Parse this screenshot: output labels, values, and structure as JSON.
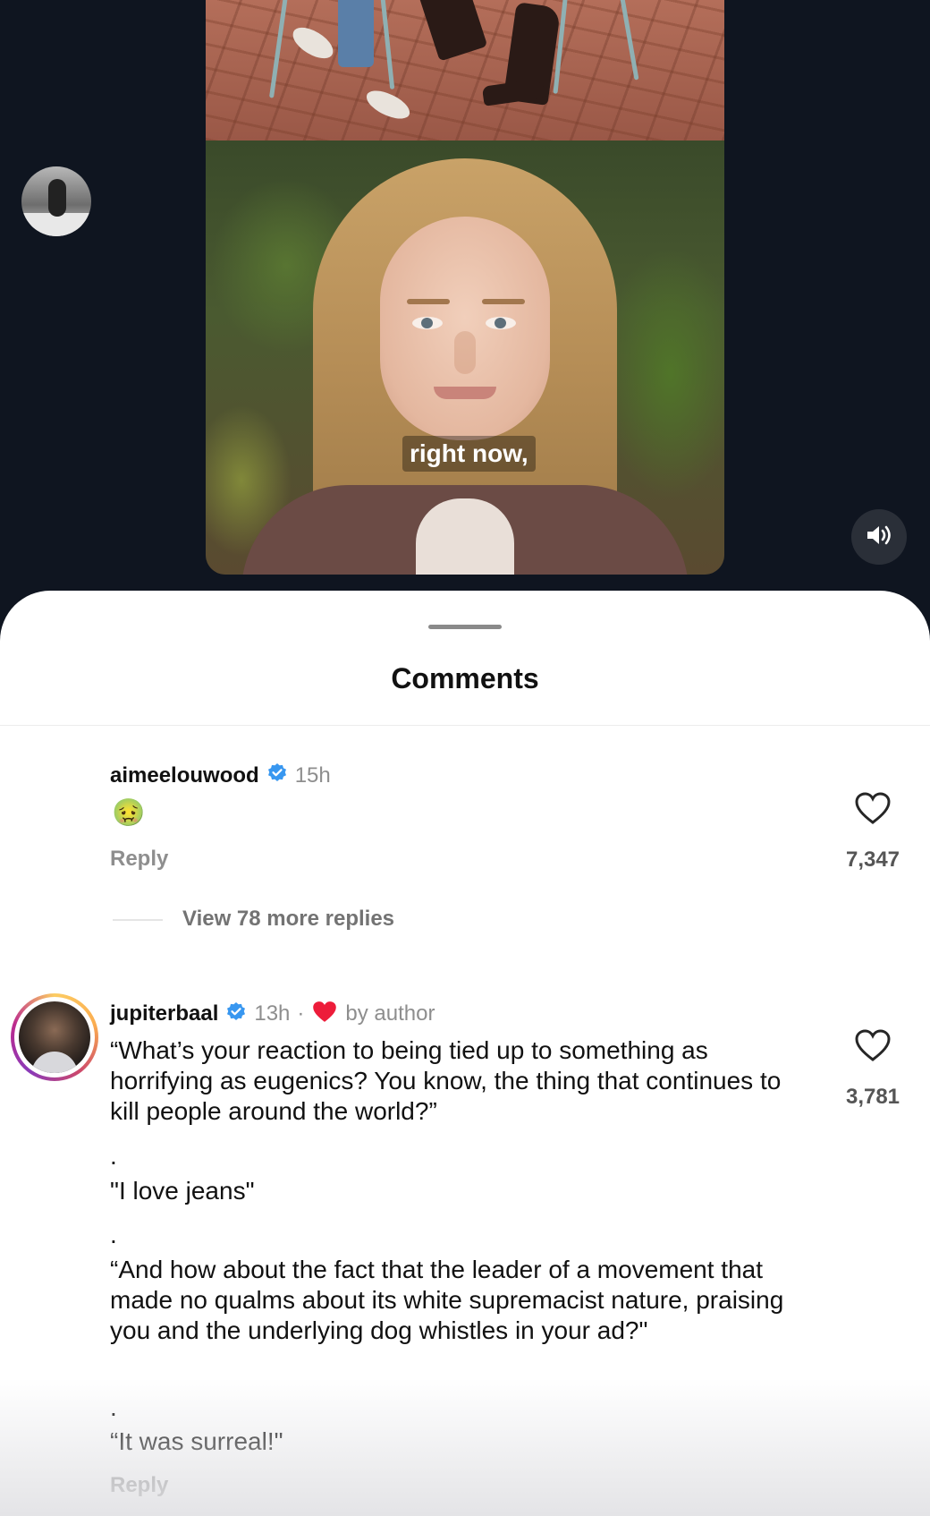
{
  "video": {
    "caption": "right now,",
    "mute_icon": "speaker-on-icon"
  },
  "comments_sheet": {
    "title": "Comments",
    "comments": [
      {
        "username": "aimeelouwood",
        "verified": true,
        "time": "15h",
        "text": "🤢",
        "reply_label": "Reply",
        "likes": "7,347",
        "view_replies": "View 78 more replies"
      },
      {
        "username": "jupiterbaal",
        "verified": true,
        "time": "13h",
        "separator": "·",
        "liked_by_author": "by author",
        "text_lines": [
          "“What’s your reaction to being tied up to something as horrifying as eugenics? You know, the thing that continues to kill people around the world?”",
          ".",
          "\"I love jeans\"",
          ".",
          "“And how about the fact that the leader of a movement that made no qualms about its white supremacist nature, praising you and the underlying dog whistles in your ad?\"",
          ".",
          "“It was surreal!\""
        ],
        "reply_label": "Reply",
        "likes": "3,781"
      }
    ]
  },
  "colors": {
    "background_dark": "#0f1520",
    "verified_blue": "#3897f0",
    "heart_red": "#ed1c3a",
    "meta_gray": "#8e8e8e"
  }
}
